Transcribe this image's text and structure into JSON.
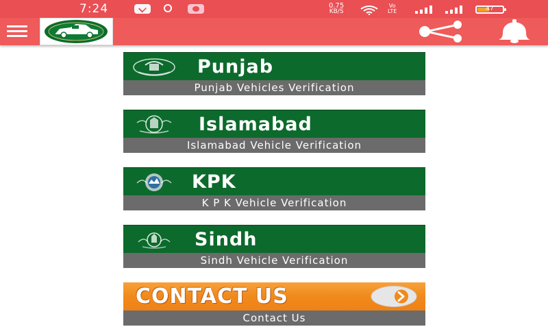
{
  "status_bar": {
    "time": "7:24",
    "net_speed_value": "0.75",
    "net_speed_unit": "KB/S",
    "volte_top": "Vo",
    "volte_bottom": "LTE",
    "battery_level": "47",
    "battery_fraction": 0.47
  },
  "app_bar": {
    "background_color": "#ef5a5a",
    "menu_icon": "hamburger-icon",
    "share_icon": "share-icon",
    "bell_icon": "bell-icon"
  },
  "cards": [
    {
      "title": "Punjab",
      "subtitle": "Punjab Vehicles Verification"
    },
    {
      "title": "Islamabad",
      "subtitle": "Islamabad Vehicle Verification"
    },
    {
      "title": "KPK",
      "subtitle": "K P K Vehicle Verification"
    },
    {
      "title": "Sindh",
      "subtitle": "Sindh Vehicle Verification"
    }
  ],
  "contact": {
    "title": "CONTACT US",
    "subtitle": "Contact Us"
  },
  "colors": {
    "card_green": "#0c6a2c",
    "label_gray": "#6b6b6b",
    "contact_orange": "#f08a1c",
    "status_bar": "#e94f53"
  }
}
